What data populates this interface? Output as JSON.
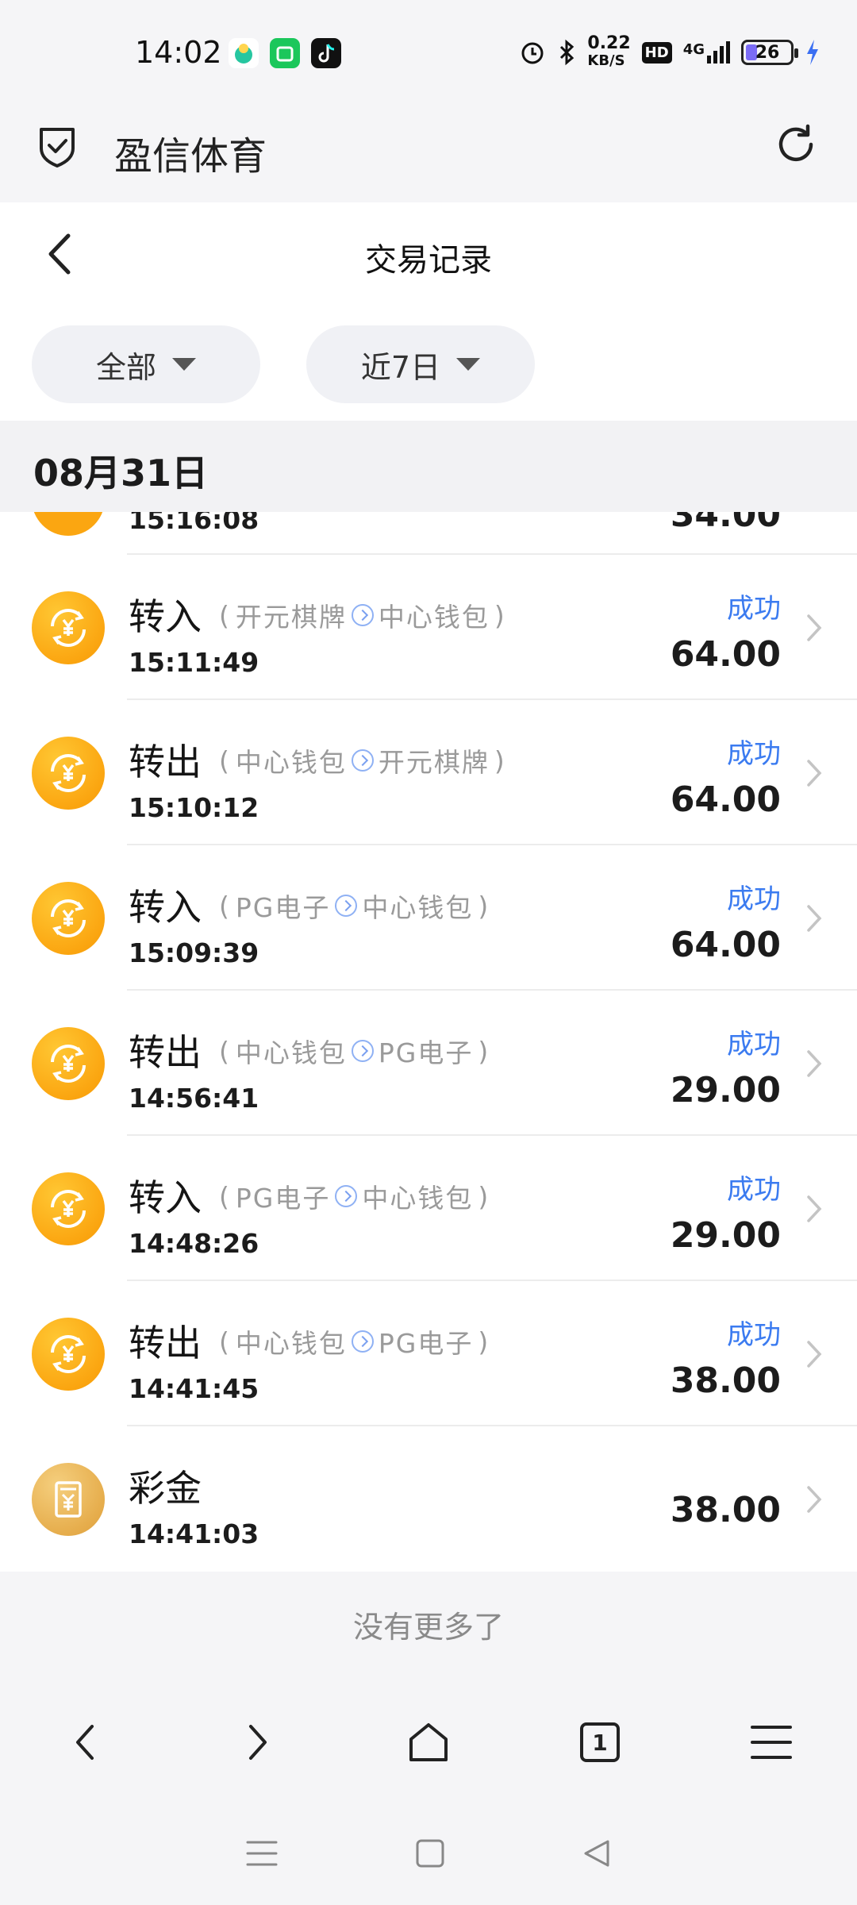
{
  "status_bar": {
    "time": "14:02",
    "net_speed_value": "0.22",
    "net_speed_unit": "KB/S",
    "hd_label": "HD",
    "network_label": "4G",
    "battery": "26"
  },
  "browser": {
    "site_title": "盈信体育"
  },
  "header": {
    "title": "交易记录",
    "filter_type": "全部",
    "filter_range": "近7日"
  },
  "date_label": "08月31日",
  "partial_row": {
    "time": "15:16:08",
    "amount": "34.00"
  },
  "transactions": [
    {
      "type": "转入",
      "from": "开元棋牌",
      "to": "中心钱包",
      "time": "15:11:49",
      "status": "成功",
      "amount": "64.00"
    },
    {
      "type": "转出",
      "from": "中心钱包",
      "to": "开元棋牌",
      "time": "15:10:12",
      "status": "成功",
      "amount": "64.00"
    },
    {
      "type": "转入",
      "from": "PG电子",
      "to": "中心钱包",
      "time": "15:09:39",
      "status": "成功",
      "amount": "64.00"
    },
    {
      "type": "转出",
      "from": "中心钱包",
      "to": "PG电子",
      "time": "14:56:41",
      "status": "成功",
      "amount": "29.00"
    },
    {
      "type": "转入",
      "from": "PG电子",
      "to": "中心钱包",
      "time": "14:48:26",
      "status": "成功",
      "amount": "29.00"
    },
    {
      "type": "转出",
      "from": "中心钱包",
      "to": "PG电子",
      "time": "14:41:45",
      "status": "成功",
      "amount": "38.00"
    }
  ],
  "bonus_row": {
    "type": "彩金",
    "time": "14:41:03",
    "amount": "38.00"
  },
  "no_more": "没有更多了",
  "tab_count": "1",
  "colors": {
    "accent_blue": "#3b7bf0",
    "coin_orange": "#fba611",
    "bonus_gold": "#e6ad4c"
  }
}
